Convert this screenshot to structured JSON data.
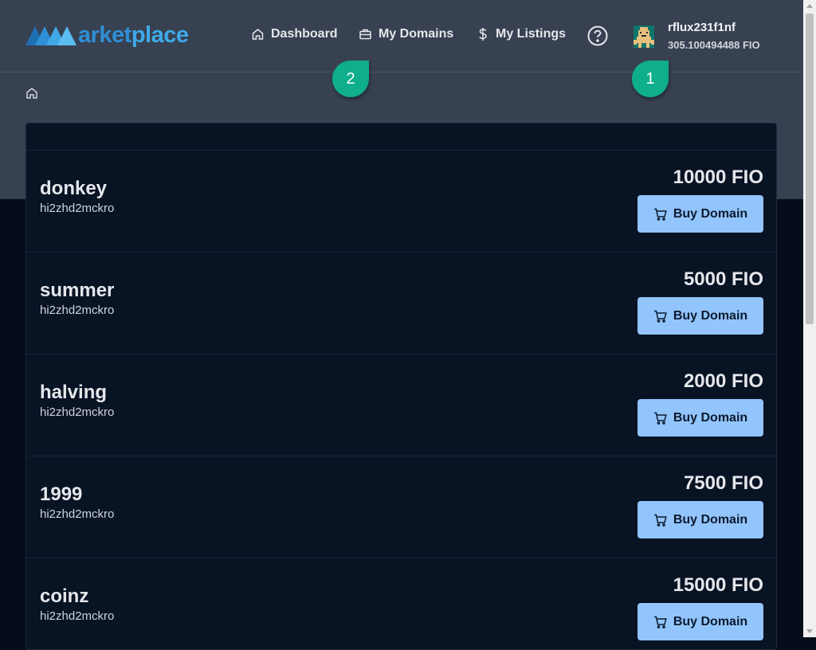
{
  "logo": {
    "part_a": "arket",
    "part_b": "place"
  },
  "nav": {
    "dashboard": "Dashboard",
    "my_domains": "My Domains",
    "my_listings": "My Listings"
  },
  "user": {
    "name": "rflux231f1nf",
    "balance": "305.100494488 FIO"
  },
  "markers": {
    "first": "1",
    "second": "2"
  },
  "listings": [
    {
      "name": "donkey",
      "owner": "hi2zhd2mckro",
      "price": "10000 FIO",
      "button": "Buy Domain"
    },
    {
      "name": "summer",
      "owner": "hi2zhd2mckro",
      "price": "5000 FIO",
      "button": "Buy Domain"
    },
    {
      "name": "halving",
      "owner": "hi2zhd2mckro",
      "price": "2000 FIO",
      "button": "Buy Domain"
    },
    {
      "name": "1999",
      "owner": "hi2zhd2mckro",
      "price": "7500 FIO",
      "button": "Buy Domain"
    },
    {
      "name": "coinz",
      "owner": "hi2zhd2mckro",
      "price": "15000 FIO",
      "button": "Buy Domain"
    }
  ],
  "colors": {
    "header_bg": "#374151",
    "page_bg": "#050d1a",
    "panel_bg": "#081324",
    "button_bg": "#93c5fd",
    "marker": "#0fae8c",
    "logo_blue": "#2f8fd6"
  },
  "icons": {
    "logo": "logo-m-icon",
    "dashboard": "home-icon",
    "my_domains": "briefcase-icon",
    "my_listings": "dollar-icon",
    "help": "help-circle-icon",
    "avatar": "pixel-avatar-icon",
    "breadcrumb": "home-icon",
    "buy": "cart-icon"
  }
}
